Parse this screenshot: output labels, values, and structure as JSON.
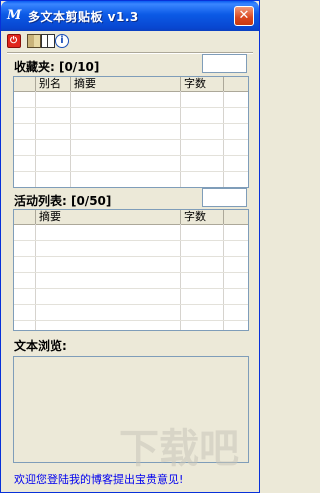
{
  "window": {
    "title": "多文本剪贴板 v1.3",
    "app_icon_letter": "M",
    "close_glyph": "✕"
  },
  "toolbar": {
    "icons": [
      "power-icon",
      "book-icon",
      "open-book-icon",
      "info-icon"
    ],
    "info_glyph": "i",
    "power_glyph": "⏻"
  },
  "favorites": {
    "label": "收藏夹: [0/10]",
    "count_value": "",
    "columns": [
      "",
      "别名",
      "摘要",
      "字数",
      ""
    ]
  },
  "activity": {
    "label": "活动列表: [0/50]",
    "count_value": "",
    "columns": [
      "",
      "摘要",
      "字数",
      ""
    ]
  },
  "preview": {
    "label": "文本浏览:",
    "content": ""
  },
  "footer": {
    "link_text": "欢迎您登陆我的博客提出宝贵意见!"
  },
  "watermark": {
    "text": "下载吧"
  }
}
